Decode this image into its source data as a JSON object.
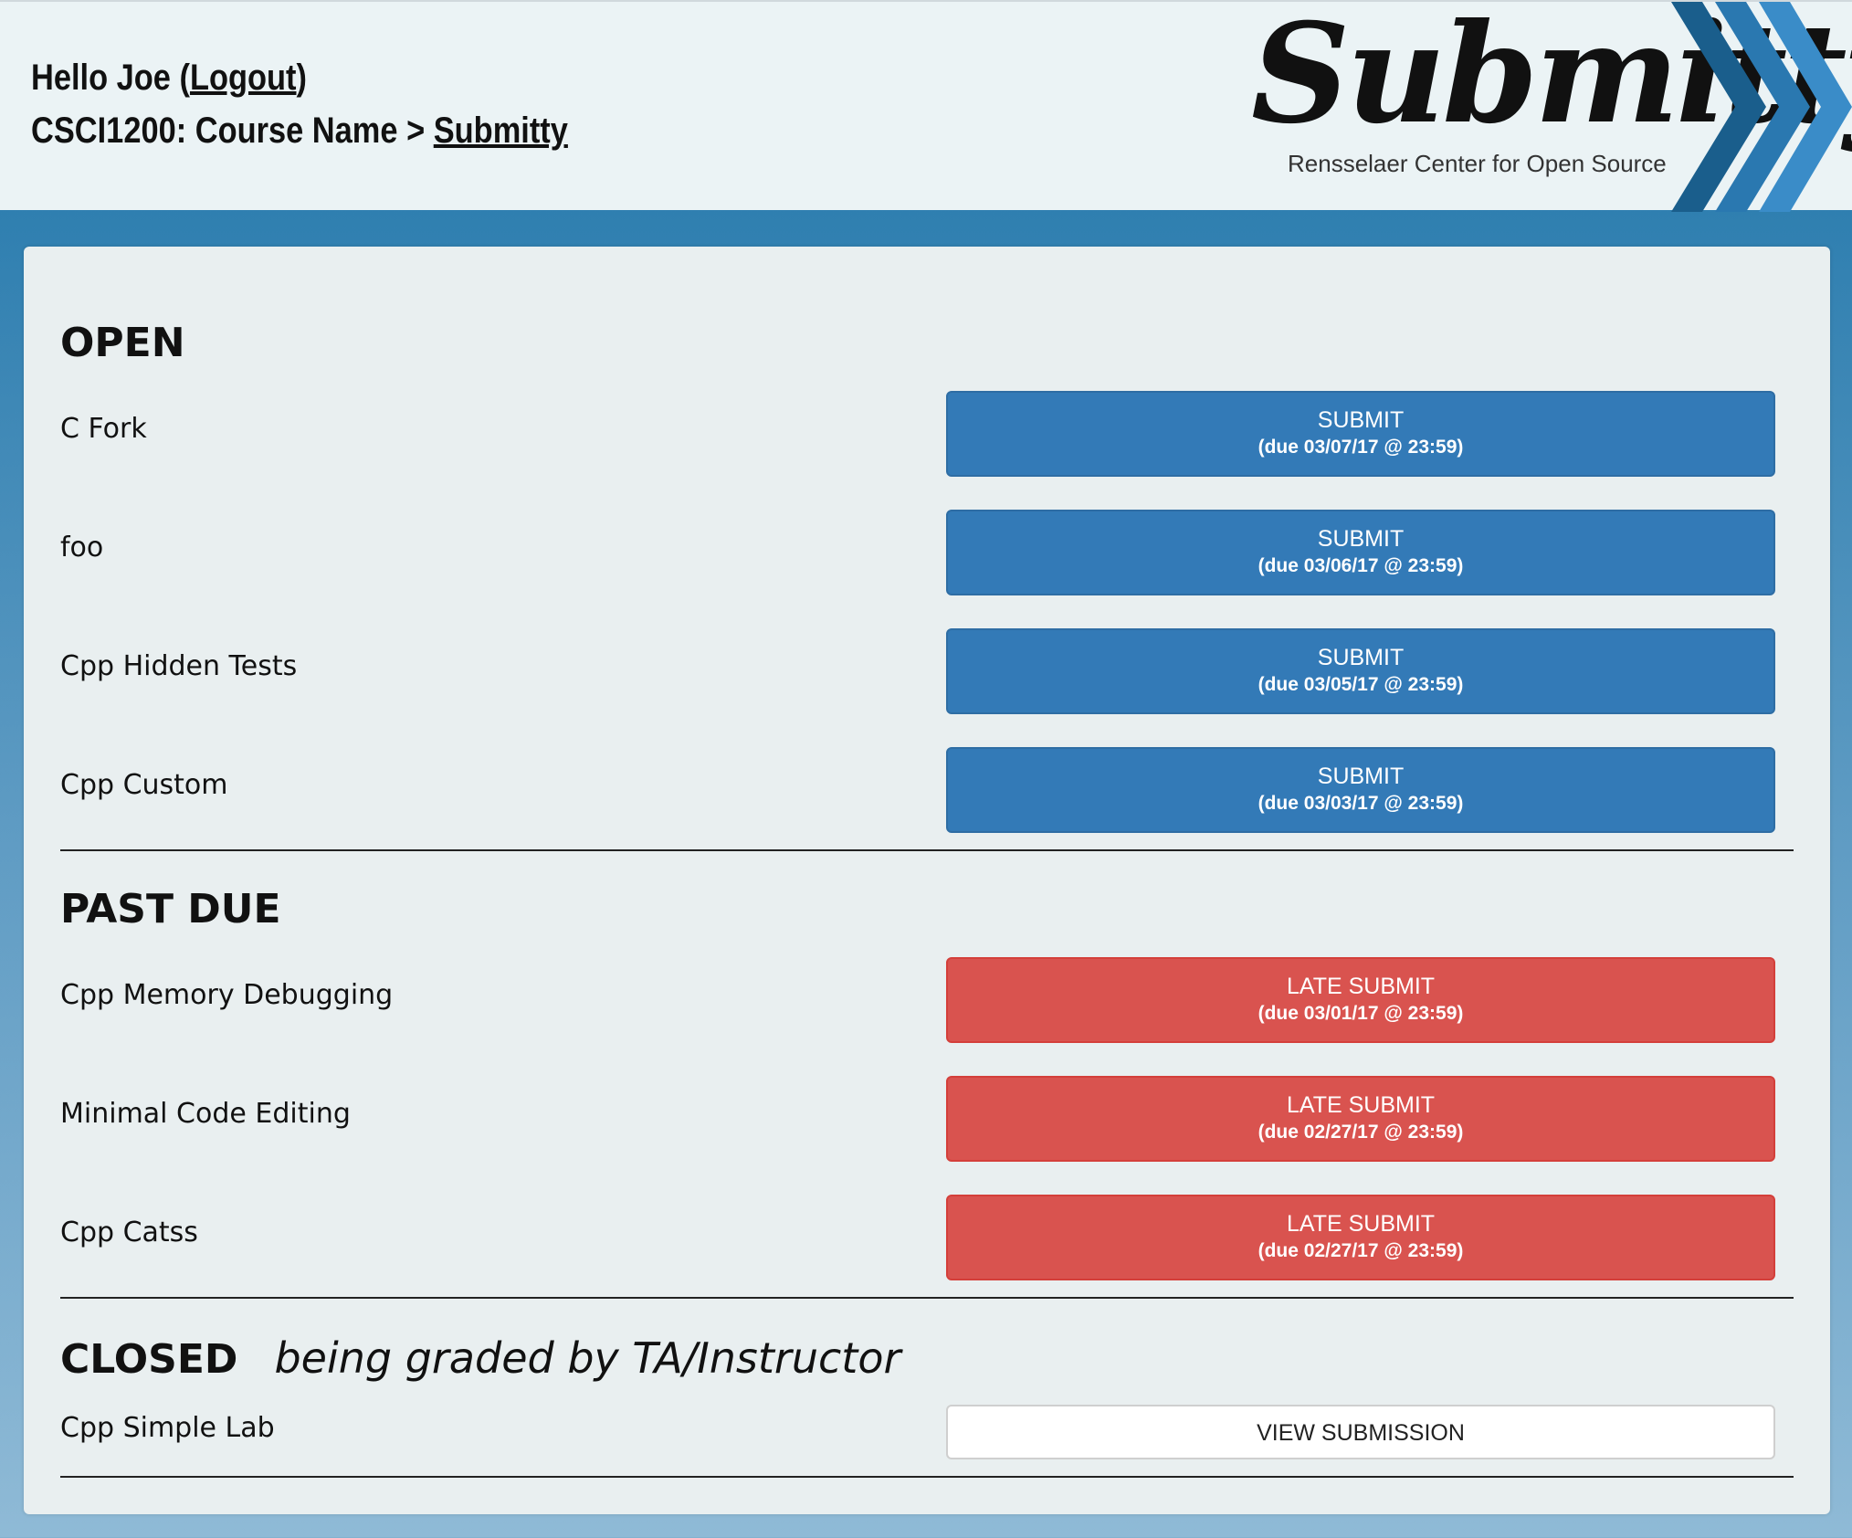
{
  "header": {
    "hello": "Hello Joe",
    "logout": "Logout",
    "course": "CSCI1200: Course Name",
    "separator": ">",
    "breadcrumb_link": "Submitty",
    "logo_text": "Submitty",
    "logo_tagline": "Rensselaer Center for Open Source",
    "colors": {
      "chevron_dark": "#1a5e8c",
      "chevron_light": "#2e86c1"
    }
  },
  "sections": {
    "open": {
      "title": "OPEN",
      "items": [
        {
          "name": "C Fork",
          "button": "SUBMIT",
          "due": "(due 03/07/17 @ 23:59)"
        },
        {
          "name": "foo",
          "button": "SUBMIT",
          "due": "(due 03/06/17 @ 23:59)"
        },
        {
          "name": "Cpp Hidden Tests",
          "button": "SUBMIT",
          "due": "(due 03/05/17 @ 23:59)"
        },
        {
          "name": "Cpp Custom",
          "button": "SUBMIT",
          "due": "(due 03/03/17 @ 23:59)"
        }
      ]
    },
    "past_due": {
      "title": "PAST DUE",
      "items": [
        {
          "name": "Cpp Memory Debugging",
          "button": "LATE SUBMIT",
          "due": "(due 03/01/17 @ 23:59)"
        },
        {
          "name": "Minimal Code Editing",
          "button": "LATE SUBMIT",
          "due": "(due 02/27/17 @ 23:59)"
        },
        {
          "name": "Cpp Catss",
          "button": "LATE SUBMIT",
          "due": "(due 02/27/17 @ 23:59)"
        }
      ]
    },
    "closed": {
      "title": "CLOSED",
      "note": "being graded by TA/Instructor",
      "items": [
        {
          "name": "Cpp Simple Lab",
          "button": "VIEW SUBMISSION"
        }
      ]
    }
  },
  "colors": {
    "submit": "#337ab7",
    "late_submit": "#d9534f",
    "view": "#ffffff",
    "panel": "#e9eff0",
    "background": "#2f7fb0"
  }
}
